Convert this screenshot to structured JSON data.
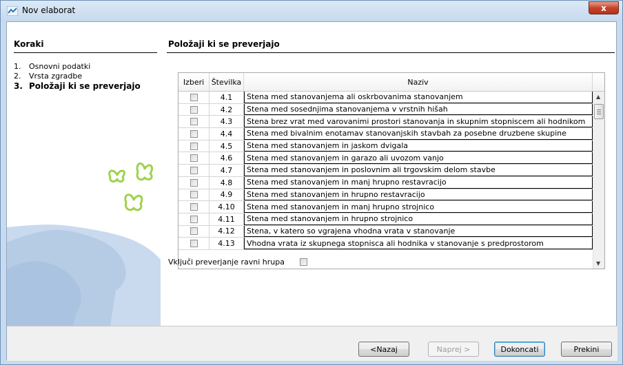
{
  "window": {
    "title": "Nov elaborat",
    "close_label": "x"
  },
  "sidebar": {
    "header": "Koraki",
    "steps": [
      {
        "num": "1.",
        "label": "Osnovni podatki"
      },
      {
        "num": "2.",
        "label": "Vrsta zgradbe"
      },
      {
        "num": "3.",
        "label": "Položaji ki se preverjajo"
      }
    ],
    "active_step": 3
  },
  "main": {
    "section_title": "Položaji ki se preverjajo",
    "table": {
      "columns": [
        "Izberi",
        "Številka",
        "Naziv"
      ],
      "rows": [
        {
          "num": "4.1",
          "name": "Stena med stanovanjema ali oskrbovanima stanovanjem",
          "checked": false
        },
        {
          "num": "4.2",
          "name": "Stena med sosednjima stanovanjema v vrstnih hišah",
          "checked": false
        },
        {
          "num": "4.3",
          "name": "Stena brez vrat med varovanimi prostori stanovanja in skupnim stopniscem ali hodnikom",
          "checked": false
        },
        {
          "num": "4.4",
          "name": "Stena med bivalnim enotamav stanovanjskih stavbah za posebne druzbene skupine",
          "checked": false
        },
        {
          "num": "4.5",
          "name": "Stena med stanovanjem in jaskom dvigala",
          "checked": false
        },
        {
          "num": "4.6",
          "name": "Stena med stanovanjem in garazo ali uvozom vanjo",
          "checked": false
        },
        {
          "num": "4.7",
          "name": "Stena med stanovanjem in poslovnim ali trgovskim delom stavbe",
          "checked": false
        },
        {
          "num": "4.8",
          "name": "Stena med stanovanjem in manj hrupno restavracijo",
          "checked": false
        },
        {
          "num": "4.9",
          "name": "Stena med stanovanjem in hrupno restavracijo",
          "checked": false
        },
        {
          "num": "4.10",
          "name": "Stena med stanovanjem in manj hrupno strojnico",
          "checked": false
        },
        {
          "num": "4.11",
          "name": "Stena med stanovanjem in hrupno strojnico",
          "checked": false
        },
        {
          "num": "4.12",
          "name": "Stena, v katero so vgrajena vhodna vrata v stanovanje",
          "checked": false
        },
        {
          "num": "4.13",
          "name": "Vhodna vrata iz skupnega stopnisca ali hodnika v stanovanje s predprostorom",
          "checked": false
        }
      ]
    },
    "include_check_label": "Vključi preverjanje ravni hrupa",
    "include_check_value": false
  },
  "footer": {
    "back_label": "<Nazaj",
    "next_label": "Naprej >",
    "finish_label": "Dokoncati",
    "cancel_label": "Prekini"
  },
  "colors": {
    "accent": "#3c7fb1",
    "bear": "#b8cee6",
    "butterfly": "#9ed24a"
  }
}
